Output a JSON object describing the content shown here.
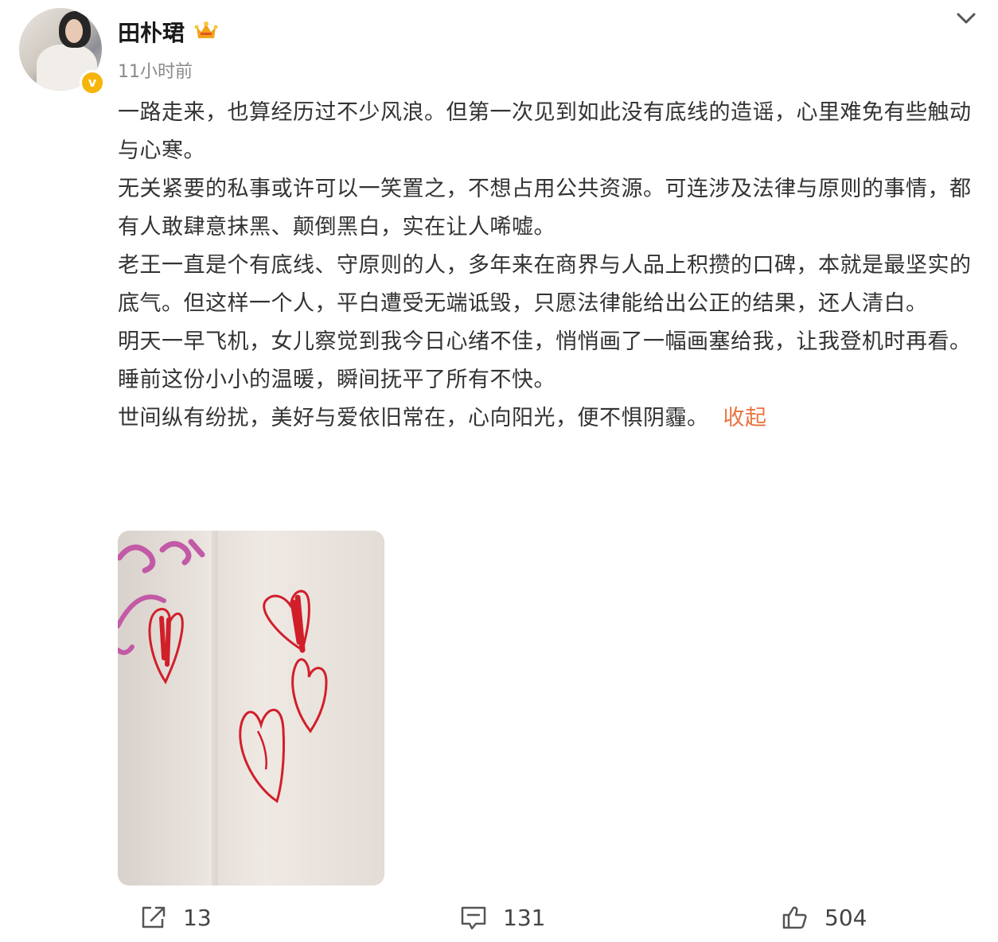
{
  "post": {
    "author": "田朴珺",
    "time": "11小时前",
    "paragraphs": [
      "一路走来，也算经历过不少风浪。但第一次见到如此没有底线的造谣，心里难免有些触动与心寒。",
      "无关紧要的私事或许可以一笑置之，不想占用公共资源。可连涉及法律与原则的事情，都有人敢肆意抹黑、颠倒黑白，实在让人唏嘘。",
      "老王一直是个有底线、守原则的人，多年来在商界与人品上积攒的口碑，本就是最坚实的底气。但这样一个人，平白遭受无端诋毁，只愿法律能给出公正的结果，还人清白。",
      "明天一早飞机，女儿察觉到我今日心绪不佳，悄悄画了一幅画塞给我，让我登机时再看。",
      "睡前这份小小的温暖，瞬间抚平了所有不快。",
      "世间纵有纷扰，美好与爱依旧常在，心向阳光，便不惧阴霾。"
    ],
    "collapse_label": "收起"
  },
  "actions": {
    "share_count": "13",
    "comment_count": "131",
    "like_count": "504"
  },
  "icons": {
    "verified": "verified-badge-icon",
    "member": "crown-icon",
    "menu": "chevron-down-icon",
    "share": "share-icon",
    "comment": "comment-icon",
    "like": "thumbs-up-icon"
  },
  "colors": {
    "accent": "#eb7340",
    "verified": "#f6b50a",
    "text": "#333333",
    "muted": "#8a8a8a"
  }
}
